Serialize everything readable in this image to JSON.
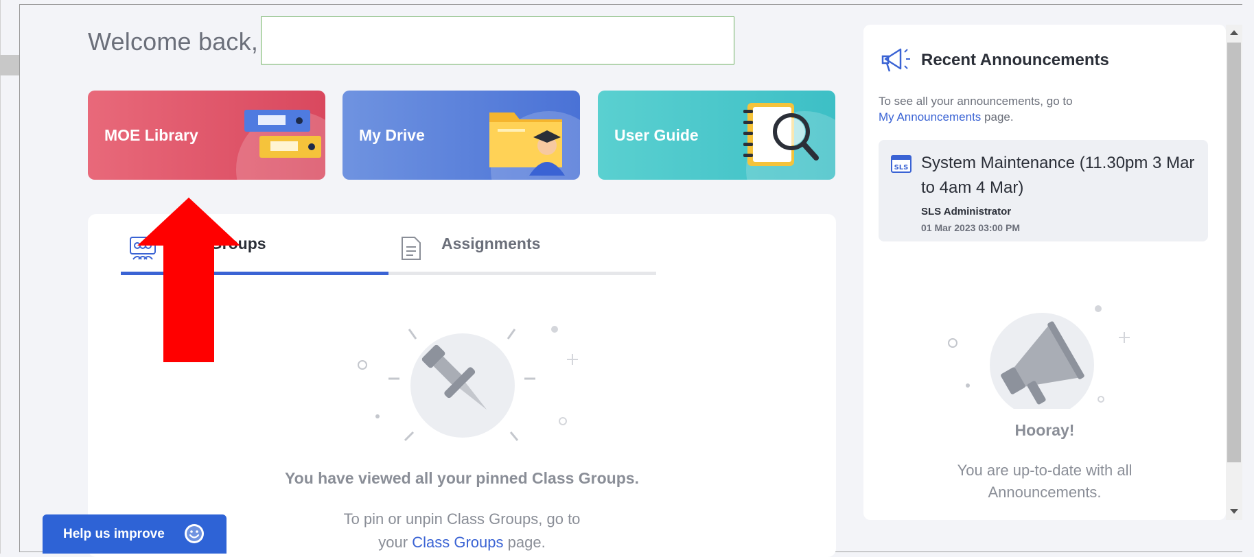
{
  "header": {
    "welcome_text": "Welcome back,"
  },
  "tiles": [
    {
      "label": "MOE Library",
      "color": "#de5368"
    },
    {
      "label": "My Drive",
      "color": "#5a80da"
    },
    {
      "label": "User Guide",
      "color": "#48c6cb"
    }
  ],
  "tabs": {
    "class_groups": "Class Groups",
    "assignments": "Assignments"
  },
  "empty_state": {
    "title": "You have viewed all your pinned Class Groups.",
    "sub_prefix": "To pin or unpin Class Groups, go to",
    "sub_your": "your",
    "sub_link": "Class Groups",
    "sub_suffix": "page."
  },
  "announcements": {
    "title": "Recent Announcements",
    "hint_prefix": "To see all your announcements, go to",
    "hint_link": "My Announcements",
    "hint_suffix": "page.",
    "item": {
      "badge": "SLS",
      "title": "System Maintenance (11.30pm 3 Mar to 4am 4 Mar)",
      "author": "SLS Administrator",
      "date": "01 Mar 2023 03:00 PM"
    },
    "empty_title": "Hooray!",
    "empty_sub": "You are up-to-date with all Announcements."
  },
  "help": {
    "label": "Help us improve"
  },
  "colors": {
    "accent": "#3a63d4",
    "arrow": "#ff0000"
  }
}
